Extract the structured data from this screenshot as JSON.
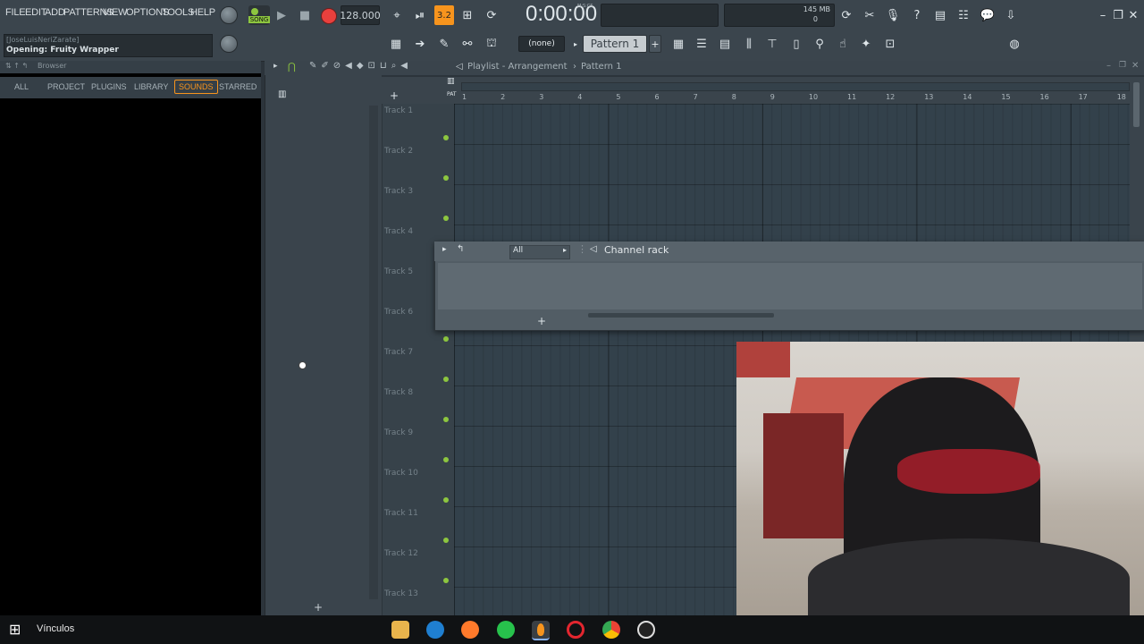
{
  "menu": [
    "FILE",
    "EDIT",
    "ADD",
    "PATTERNS",
    "VIEW",
    "OPTIONS",
    "TOOLS",
    "HELP"
  ],
  "transport": {
    "song_label": "SONG",
    "tempo": "128.000",
    "time": "0:00:00",
    "time_unit": "M:S:CS",
    "memory": "145 MB",
    "cpu": "0",
    "pattern_num": "3.2"
  },
  "hint": {
    "user": "[JoseLuisNeriZarate]",
    "status": "Opening: Fruity Wrapper"
  },
  "row2": {
    "snap": "(none)",
    "pattern": "Pattern 1",
    "pattern_add": "+"
  },
  "browser": {
    "title": "Browser",
    "tabs": [
      "ALL",
      "PROJECT",
      "PLUGINS",
      "LIBRARY",
      "SOUNDS",
      "STARRED"
    ],
    "active_tab": "SOUNDS"
  },
  "playlist": {
    "breadcrumb": "Playlist - Arrangement",
    "pattern": "Pattern 1",
    "ruler": [
      "1",
      "2",
      "3",
      "4",
      "5",
      "6",
      "7",
      "8",
      "9",
      "10",
      "11",
      "12",
      "13",
      "14",
      "15",
      "16",
      "17",
      "18"
    ],
    "tracks": [
      "Track 1",
      "Track 2",
      "Track 3",
      "Track 4",
      "Track 5",
      "Track 6",
      "Track 7",
      "Track 8",
      "Track 9",
      "Track 10",
      "Track 11",
      "Track 12",
      "Track 13"
    ],
    "add": "+",
    "pat_label": "PAT"
  },
  "channel_rack": {
    "filter": "All",
    "title": "Channel rack",
    "add": "+"
  },
  "taskbar": {
    "search_label": "Vínculos"
  },
  "colors": {
    "accent_orange": "#f7941d",
    "track_dot": "#8dc63f",
    "record": "#e8403d"
  },
  "icons": [
    "windows-icon",
    "file-explorer-icon",
    "edge-icon",
    "firefox-icon",
    "whatsapp-icon",
    "fl-studio-icon",
    "opera-icon",
    "chrome-icon",
    "obs-icon"
  ]
}
